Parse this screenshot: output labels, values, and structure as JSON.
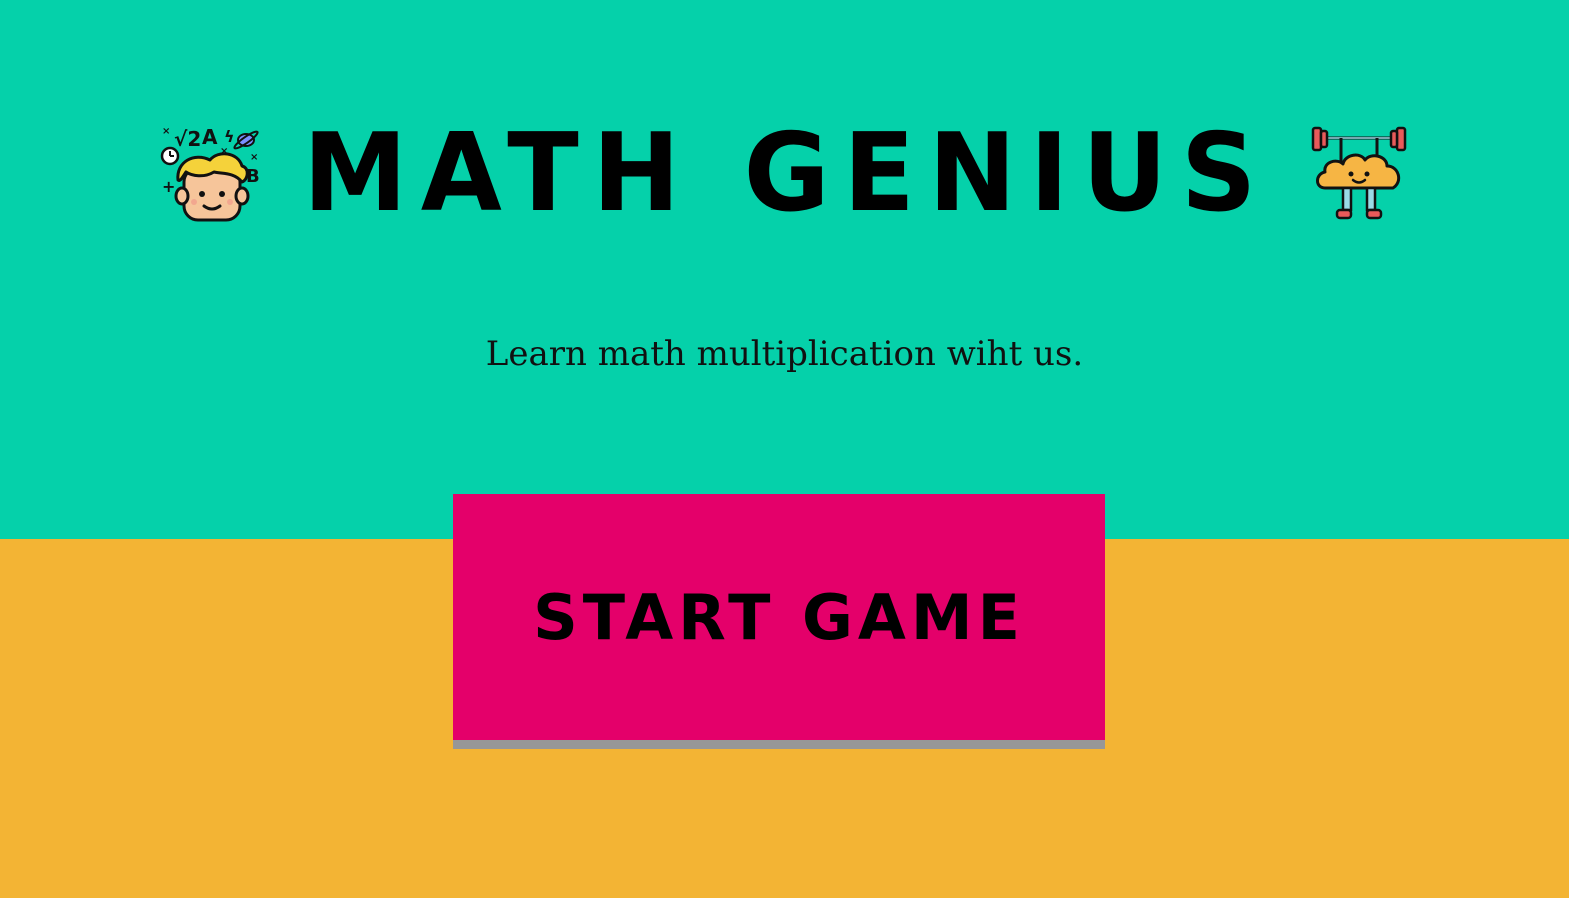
{
  "header": {
    "title": "MATH GENIUS",
    "left_icon": "genius-kid-icon",
    "right_icon": "brain-weightlifting-icon"
  },
  "subtitle": "Learn math multiplication wiht us.",
  "start_button": {
    "label": "START GAME"
  },
  "colors": {
    "top_background": "#05d1aa",
    "bottom_background": "#f3b434",
    "button": "#e4006a",
    "button_shadow": "#979797"
  }
}
